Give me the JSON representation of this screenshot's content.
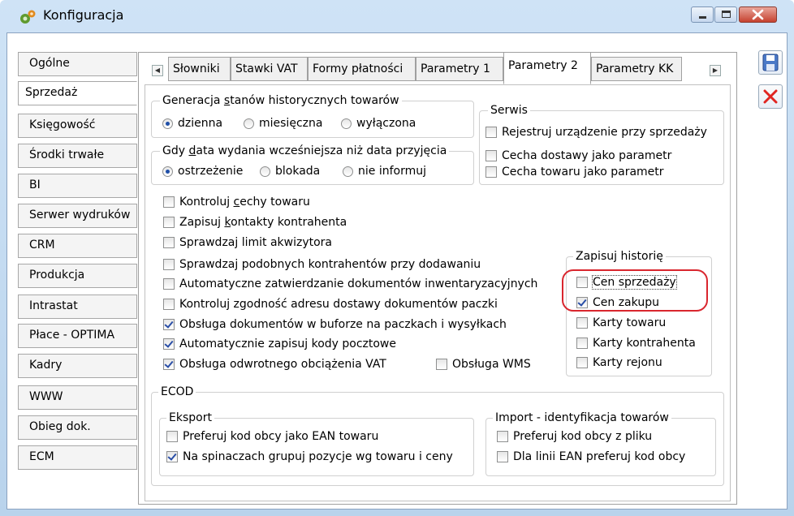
{
  "window": {
    "title": "Konfiguracja"
  },
  "sidebar": {
    "items": [
      {
        "label": "Ogólne"
      },
      {
        "label": "Sprzedaż"
      },
      {
        "label": "Księgowość"
      },
      {
        "label": "Środki trwałe"
      },
      {
        "label": "BI"
      },
      {
        "label": "Serwer wydruków"
      },
      {
        "label": "CRM"
      },
      {
        "label": "Produkcja"
      },
      {
        "label": "Intrastat"
      },
      {
        "label": "Płace - OPTIMA"
      },
      {
        "label": "Kadry"
      },
      {
        "label": "WWW"
      },
      {
        "label": "Obieg dok."
      },
      {
        "label": "ECM"
      }
    ],
    "selected": "Sprzedaż"
  },
  "tabs": [
    {
      "label": "Słowniki"
    },
    {
      "label": "Stawki VAT"
    },
    {
      "label": "Formy płatności"
    },
    {
      "label": "Parametry 1"
    },
    {
      "label": "Parametry 2"
    },
    {
      "label": "Parametry KK"
    }
  ],
  "historic": {
    "legend": "Generacja stanów historycznych towarów",
    "options": [
      {
        "label": "dzienna",
        "checked": true
      },
      {
        "label": "miesięczna",
        "checked": false
      },
      {
        "label": "wyłączona",
        "checked": false
      }
    ]
  },
  "release": {
    "legend": "Gdy data wydania wcześniejsza niż data przyjęcia",
    "options": [
      {
        "label": "ostrzeżenie",
        "checked": true
      },
      {
        "label": "blokada",
        "checked": false
      },
      {
        "label": "nie informuj",
        "checked": false
      }
    ]
  },
  "serwis": {
    "legend": "Serwis",
    "items": [
      {
        "label": "Rejestruj urządzenie przy sprzedaży",
        "checked": false
      },
      {
        "label": "Cecha dostawy jako parametr",
        "checked": false
      },
      {
        "label": "Cecha towaru jako parametr",
        "checked": false
      }
    ]
  },
  "options": [
    {
      "label": "Kontroluj cechy towaru",
      "checked": false
    },
    {
      "label": "Zapisuj kontakty kontrahenta",
      "checked": false
    },
    {
      "label": "Sprawdzaj limit akwizytora",
      "checked": false
    },
    {
      "label": "Sprawdzaj podobnych kontrahentów przy dodawaniu",
      "checked": false
    },
    {
      "label": "Automatyczne zatwierdzanie dokumentów inwentaryzacyjnych",
      "checked": false
    },
    {
      "label": "Kontroluj zgodność adresu dostawy dokumentów paczki",
      "checked": false
    },
    {
      "label": "Obsługa dokumentów w buforze na paczkach i wysyłkach",
      "checked": true
    },
    {
      "label": "Automatycznie zapisuj kody pocztowe",
      "checked": true
    },
    {
      "label": "Obsługa odwrotnego obciążenia VAT",
      "checked": true
    }
  ],
  "wms": {
    "label": "Obsługa WMS",
    "checked": false
  },
  "history": {
    "legend": "Zapisuj historię",
    "items": [
      {
        "label": "Cen sprzedaży",
        "checked": false
      },
      {
        "label": "Cen zakupu",
        "checked": true
      },
      {
        "label": "Karty towaru",
        "checked": false
      },
      {
        "label": "Karty kontrahenta",
        "checked": false
      },
      {
        "label": "Karty rejonu",
        "checked": false
      }
    ]
  },
  "ecod": {
    "legend": "ECOD",
    "export": {
      "legend": "Eksport",
      "items": [
        {
          "label": "Preferuj kod obcy jako EAN towaru",
          "checked": false
        },
        {
          "label": "Na spinaczach grupuj pozycje wg towaru i ceny",
          "checked": true
        }
      ]
    },
    "import": {
      "legend": "Import - identyfikacja towarów",
      "items": [
        {
          "label": "Preferuj kod obcy z pliku",
          "checked": false
        },
        {
          "label": "Dla linii EAN preferuj kod obcy",
          "checked": false
        }
      ]
    }
  },
  "colors": {
    "highlight": "#d9262e",
    "checkmark": "#2a4ea6"
  }
}
